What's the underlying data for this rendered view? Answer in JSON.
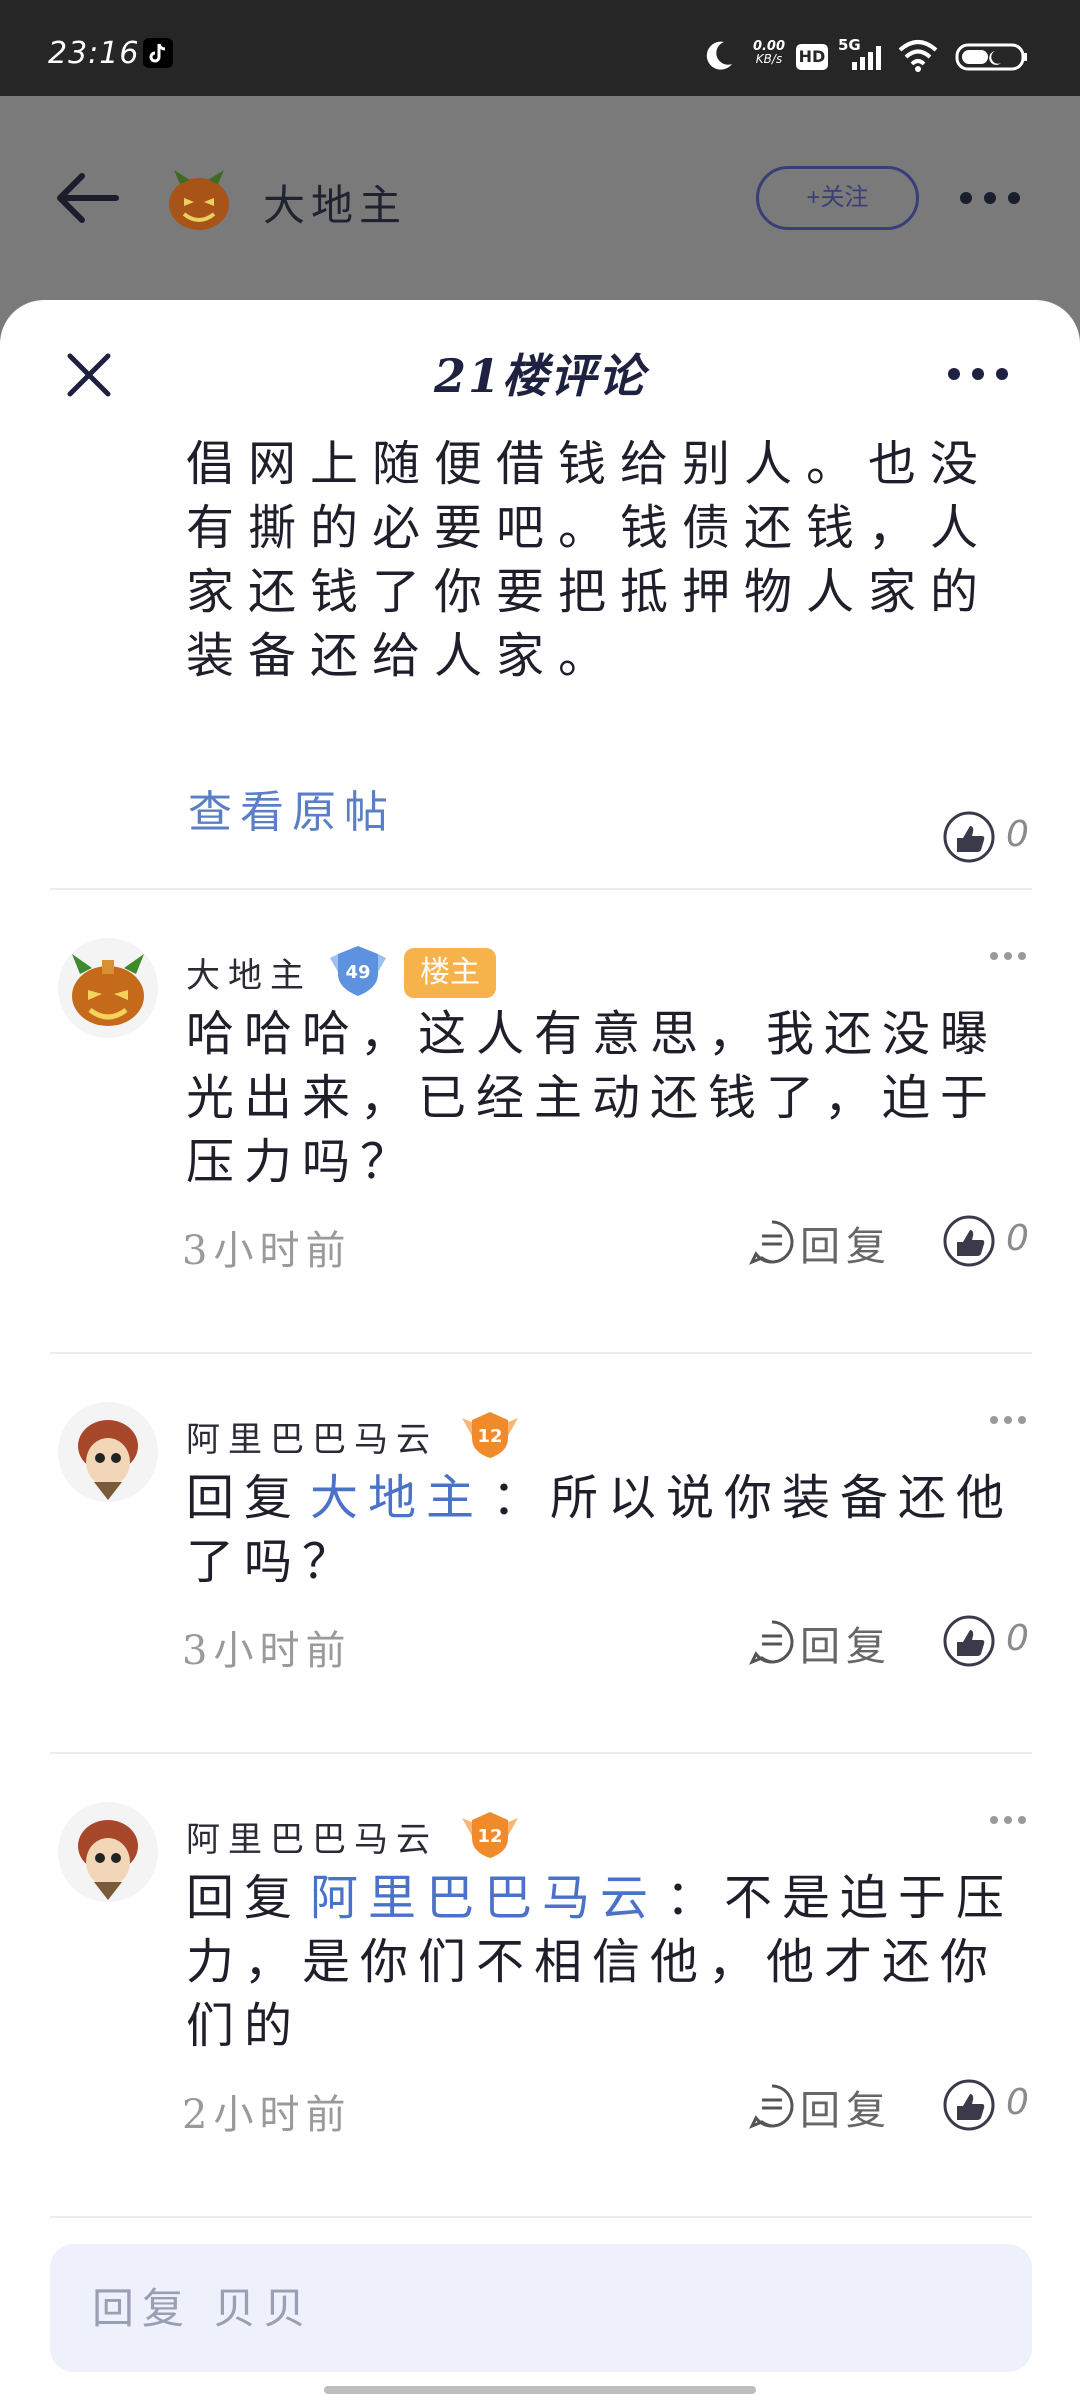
{
  "status_bar": {
    "time": "23:16",
    "net_speed_value": "0.00",
    "net_speed_unit": "KB/s",
    "hd_label": "HD",
    "network_type": "5G"
  },
  "header": {
    "user_name": "大地主",
    "follow_label": "+关注"
  },
  "sheet": {
    "title": "21楼评论",
    "original_text": "应该把装备还给他。不过不提倡网上随便借钱给别人。也没有撕的必要吧。钱债还钱，人家还钱了你要把抵押物人家的装备还给人家。",
    "view_original_label": "查看原帖",
    "original_like_count": "0"
  },
  "comments": [
    {
      "name": "大地主",
      "level": "49",
      "owner_badge": "楼主",
      "reply_prefix": "",
      "reply_target": "",
      "text": "哈哈哈，这人有意思，我还没曝光出来，已经主动还钱了，迫于压力吗？",
      "time": "3小时前",
      "reply_label": "回复",
      "like_count": "0"
    },
    {
      "name": "阿里巴巴马云",
      "level": "12",
      "owner_badge": "",
      "reply_prefix": "回复",
      "reply_target": "大地主",
      "text": "：所以说你装备还他了吗？",
      "time": "3小时前",
      "reply_label": "回复",
      "like_count": "0"
    },
    {
      "name": "阿里巴巴马云",
      "level": "12",
      "owner_badge": "",
      "reply_prefix": "回复",
      "reply_target": "阿里巴巴马云",
      "text": "：不是迫于压力，是你们不相信他，他才还你们的",
      "time": "2小时前",
      "reply_label": "回复",
      "like_count": "0"
    }
  ],
  "input": {
    "placeholder": "回复 贝贝"
  },
  "colors": {
    "accent_link": "#4a72c8",
    "owner_badge": "#f6b24b",
    "follow_border": "#3a3e78"
  }
}
